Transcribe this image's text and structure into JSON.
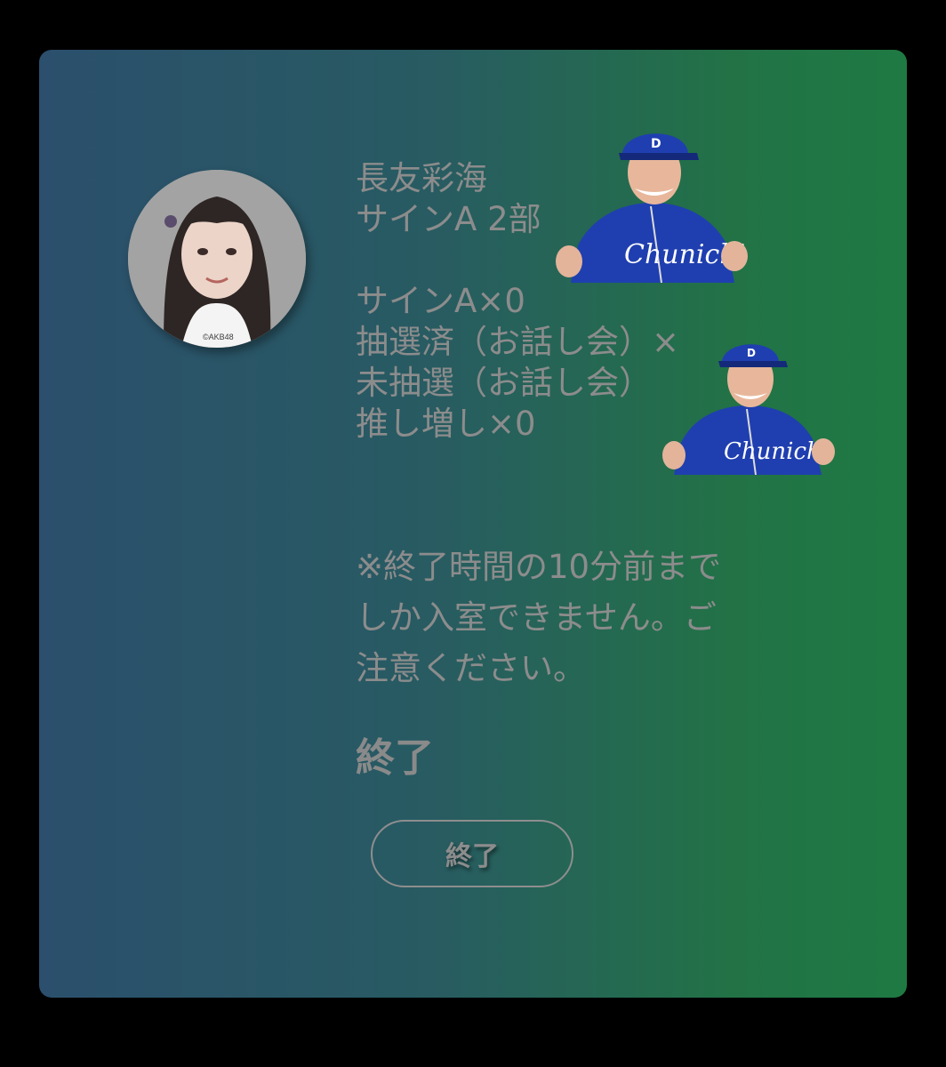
{
  "member": {
    "name": "長友彩海",
    "session": "サインA 2部",
    "credit": "©AKB48"
  },
  "tickets": [
    "サインA×0",
    "抽選済（お話し会）×",
    "未抽選（お話し会）",
    "推し増し×0"
  ],
  "notice_lines": [
    "※終了時間の10分前まで",
    "しか入室できません。ご",
    "注意ください。"
  ],
  "status": "終了",
  "end_button_label": "終了",
  "sticker_text": "Chunichi",
  "colors": {
    "gradient_left": "#2b4f6c",
    "gradient_right": "#1e7a42",
    "text": "#8c8c8c",
    "uniform_blue": "#1f3fb0"
  }
}
